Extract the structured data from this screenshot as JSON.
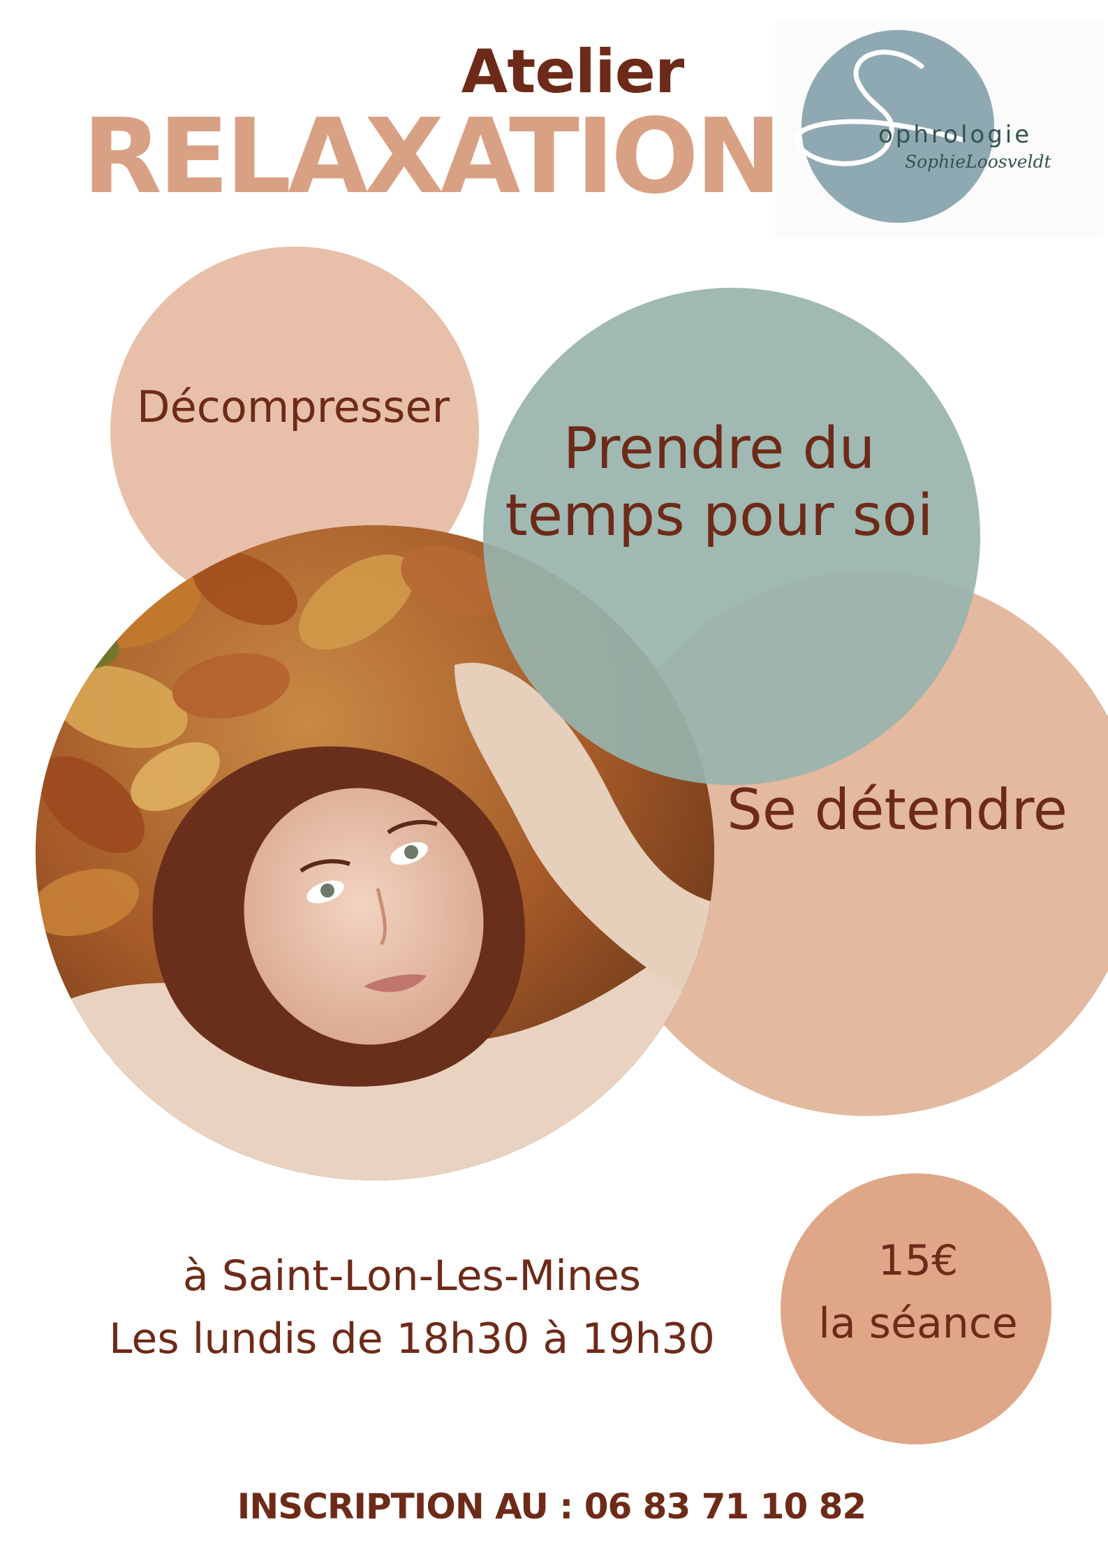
{
  "header": {
    "subtitle": "Atelier",
    "title": "RELAXATION"
  },
  "logo": {
    "wordmark": "ophrologie",
    "name": "SophieLoosveldt"
  },
  "bubbles": {
    "decompress": "Décompresser",
    "take_time": "Prendre du temps pour soi",
    "relax": "Se détendre"
  },
  "photo": {
    "subject": "woman-lying-on-autumn-leaves"
  },
  "info": {
    "location": "à Saint-Lon-Les-Mines",
    "schedule": "Les lundis de 18h30 à 19h30"
  },
  "price": {
    "amount": "15€",
    "unit": "la séance"
  },
  "contact": {
    "inscription": "INSCRIPTION AU : 06 83 71 10 82"
  },
  "colors": {
    "title_dark": "#6e2a18",
    "title_light": "#d9a184",
    "peach": "#e8c0aa",
    "sage": "#98b3ad",
    "logo_blue": "#8fa9b3"
  }
}
